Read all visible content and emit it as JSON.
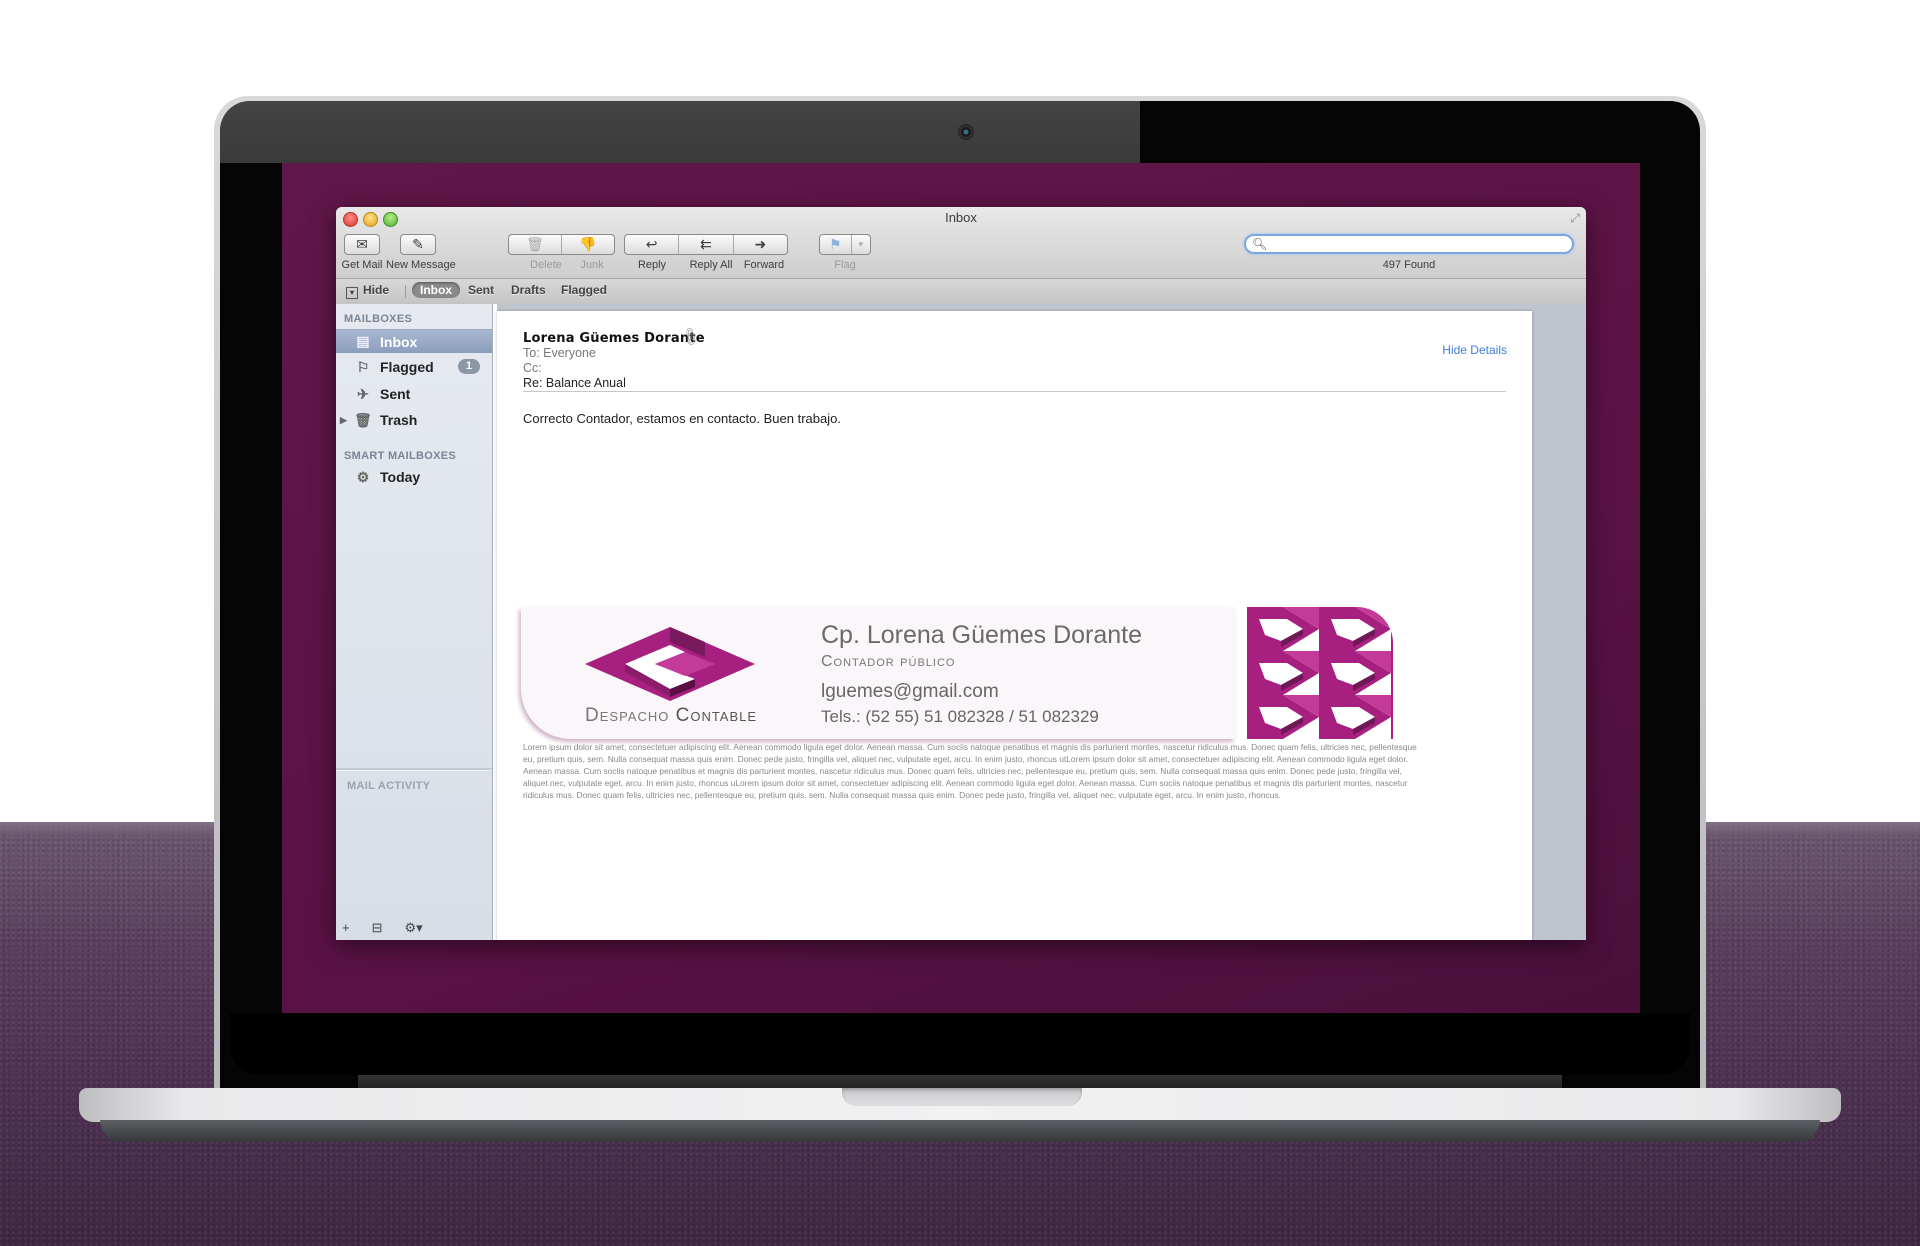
{
  "window": {
    "title": "Inbox"
  },
  "toolbar": {
    "get_mail": "Get Mail",
    "new_message": "New Message",
    "delete": "Delete",
    "junk": "Junk",
    "reply": "Reply",
    "reply_all": "Reply All",
    "forward": "Forward",
    "flag": "Flag",
    "search_value": "",
    "search_placeholder": "",
    "found_count": "497 Found"
  },
  "favorites": {
    "hide": "Hide",
    "items": [
      "Inbox",
      "Sent",
      "Drafts",
      "Flagged"
    ],
    "selected": "Inbox"
  },
  "sidebar": {
    "mailboxes_header": "MAILBOXES",
    "items": [
      {
        "label": "Inbox",
        "icon": "inbox-icon",
        "selected": true
      },
      {
        "label": "Flagged",
        "icon": "flag-icon",
        "badge": "1"
      },
      {
        "label": "Sent",
        "icon": "paper-plane-icon"
      },
      {
        "label": "Trash",
        "icon": "trash-icon"
      }
    ],
    "smart_header": "SMART MAILBOXES",
    "smart_items": [
      {
        "label": "Today",
        "icon": "gear-icon"
      }
    ],
    "activity_header": "MAIL ACTIVITY"
  },
  "message": {
    "from": "Lorena Güemes Dorante",
    "to": "To: Everyone",
    "cc": "Cc:",
    "subject": "Re: Balance Anual",
    "hide_details": "Hide Details",
    "body": "Correcto Contador, estamos en contacto. Buen trabajo."
  },
  "signature": {
    "company_first": "Despacho",
    "company_second": "Contable",
    "name": "Cp. Lorena Güemes Dorante",
    "title": "Contador público",
    "email": "lguemes@gmail.com",
    "phones": "Tels.: (52 55) 51 082328 / 51 082329",
    "brand_color": "#9b2180",
    "legal": "Lorem ipsum dolor sit amet, consectetuer adipiscing elit. Aenean commodo ligula eget dolor. Aenean massa. Cum sociis natoque penatibus et magnis dis parturient montes, nascetur ridiculus mus. Donec quam felis, ultricies nec, pellentesque eu, pretium quis, sem. Nulla consequat massa quis enim. Donec pede justo, fringilla vel, aliquet nec, vulputate eget, arcu. In enim justo, rhoncus utLorem ipsum dolor sit amet, consectetuer adipiscing elit. Aenean commodo ligula eget dolor. Aenean massa. Cum sociis natoque penatibus et magnis dis parturient montes, nascetur ridiculus mus. Donec quam felis, ultricies nec, pellentesque eu, pretium quis, sem. Nulla consequat massa quis enim. Donec pede justo, fringilla vel, aliquet nec, vulputate eget, arcu. In enim justo, rhoncus uLorem ipsum dolor sit amet, consectetuer adipiscing elit. Aenean commodo ligula eget dolor. Aenean massa. Cum sociis natoque penatibus et magnis dis parturient montes, nascetur ridiculus mus. Donec quam felis, ultricies nec, pellentesque eu, pretium quis, sem. Nulla consequat massa quis enim. Donec pede justo, fringilla vel, aliquet nec, vulputate eget, arcu. In enim justo, rhoncus."
  },
  "colors": {
    "desktop": "#5c1446",
    "accent_link": "#3f7ddb",
    "brand": "#9b2180"
  }
}
